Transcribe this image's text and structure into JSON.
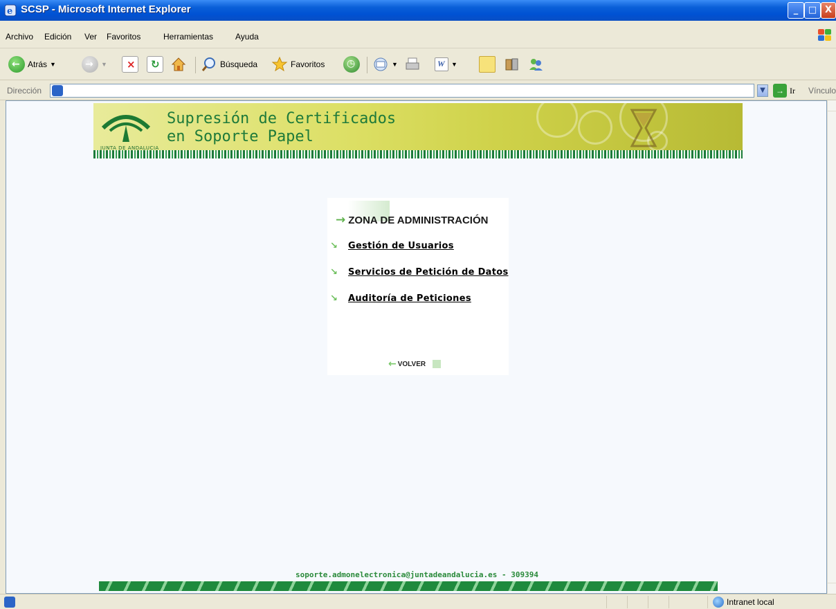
{
  "window": {
    "title": "SCSP - Microsoft Internet Explorer",
    "controls": {
      "minimize": "_",
      "maximize": "□",
      "close": "X"
    }
  },
  "menu": {
    "items": [
      "Archivo",
      "Edición",
      "Ver",
      "Favoritos",
      "Herramientas",
      "Ayuda"
    ]
  },
  "toolbar": {
    "back_label": "Atrás",
    "search_label": "Búsqueda",
    "favorites_label": "Favoritos"
  },
  "addressbar": {
    "label": "Dirección",
    "value": "",
    "go_label": "Ir",
    "links_label": "Vínculo"
  },
  "banner": {
    "title_line1": "Supresión de Certificados",
    "title_line2": "en Soporte Papel",
    "logo_text": "JUNTA DE ANDALUCIA"
  },
  "admin": {
    "header": "ZONA DE ADMINISTRACIÓN",
    "links": [
      "Gestión de Usuarios",
      "Servicios de Petición de Datos",
      "Auditoría de Peticiones"
    ],
    "back_label": "VOLVER"
  },
  "footer": {
    "contact": "soporte.admonelectronica@juntadeandalucia.es - 309394"
  },
  "statusbar": {
    "zone": "Intranet local"
  },
  "colors": {
    "brand_green": "#1e7a3a",
    "banner_yellow": "#dcdf64",
    "xp_blue": "#0051d3"
  }
}
